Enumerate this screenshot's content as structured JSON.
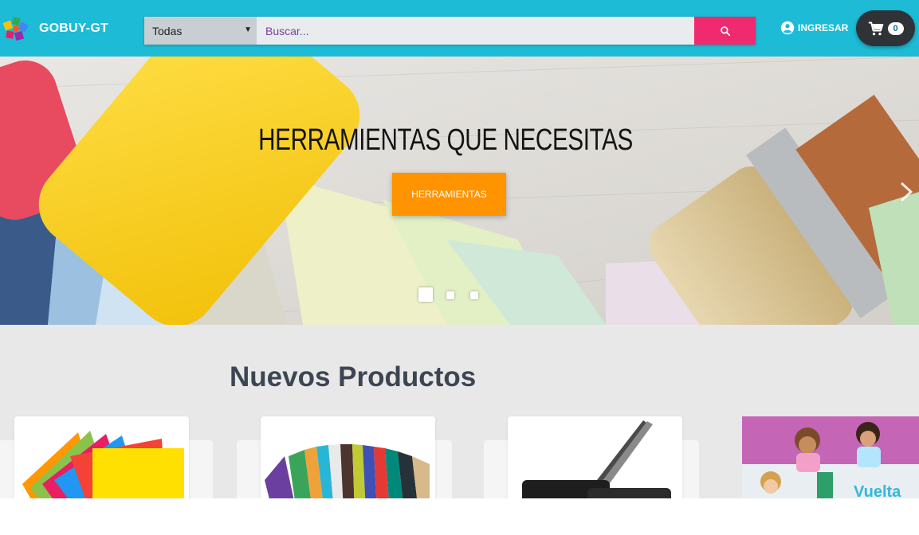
{
  "header": {
    "brand": "GOBUY-GT",
    "category_select": "Todas",
    "search_placeholder": "Buscar...",
    "login_label": "INGRESAR",
    "cart_count": "0"
  },
  "hero": {
    "title": "HERRAMIENTAS QUE NECESITAS",
    "button_label": "HERRAMIENTAS",
    "slides_total": 3,
    "active_slide": 1
  },
  "products": {
    "section_title": "Nuevos Productos",
    "promo_text": "Vuelta"
  },
  "colors": {
    "topbar": "#1dbbd6",
    "search_button": "#ef2a6e",
    "hero_button": "#ff9300",
    "section_title": "#3d4552"
  }
}
